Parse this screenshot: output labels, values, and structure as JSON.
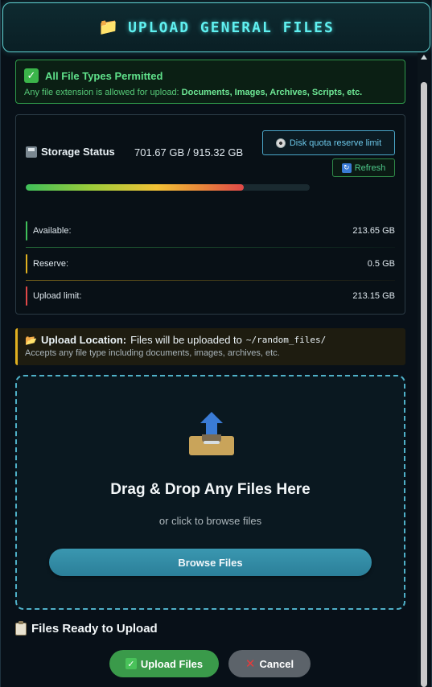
{
  "header": {
    "title": "UPLOAD GENERAL FILES",
    "icon": "folder-icon"
  },
  "permit": {
    "title": "All File Types Permitted",
    "desc_prefix": "Any file extension is allowed for upload: ",
    "desc_types": "Documents, Images, Archives, Scripts, etc."
  },
  "storage": {
    "title": "Storage Status",
    "value": "701.67 GB / 915.32 GB",
    "usage_fraction": 0.767,
    "quota_button": "Disk quota reserve limit",
    "refresh_button": "Refresh",
    "rows": [
      {
        "label": "Available:",
        "value": "213.65 GB",
        "color": "#3fbf5a"
      },
      {
        "label": "Reserve:",
        "value": "0.5 GB",
        "color": "#e0b020"
      },
      {
        "label": "Upload limit:",
        "value": "213.15 GB",
        "color": "#e04848"
      }
    ]
  },
  "location": {
    "label": "Upload Location:",
    "text": "Files will be uploaded to",
    "path": "~/random_files/",
    "desc": "Accepts any file type including documents, images, archives, etc."
  },
  "dropzone": {
    "title": "Drag & Drop Any Files Here",
    "subtitle": "or click to browse files",
    "browse_button": "Browse Files"
  },
  "ready": {
    "title": "Files Ready to Upload"
  },
  "actions": {
    "upload_label": "Upload Files",
    "cancel_label": "Cancel"
  },
  "colors": {
    "accent": "#5ff0f0",
    "success": "#3a9a4a",
    "warning": "#e0b020",
    "danger": "#e04848"
  }
}
